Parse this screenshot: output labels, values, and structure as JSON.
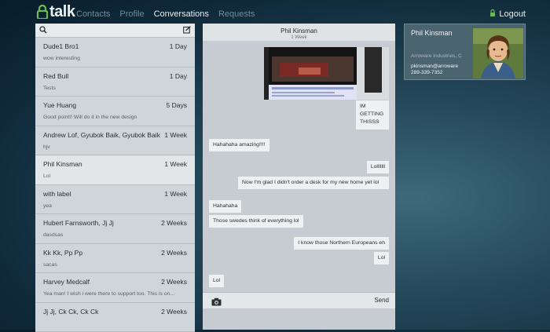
{
  "app": {
    "brand": "talk"
  },
  "nav": {
    "items": [
      "Contacts",
      "Profile",
      "Conversations",
      "Requests"
    ],
    "active": "Conversations"
  },
  "logout_label": "Logout",
  "conversations": [
    {
      "name": "Dude1 Bro1",
      "time": "1 Day",
      "preview": "wow interesting"
    },
    {
      "name": "Red Bull",
      "time": "1 Day",
      "preview": "Tests"
    },
    {
      "name": "Yue Huang",
      "time": "5 Days",
      "preview": "Good point!! Will do it in the new design"
    },
    {
      "name": "Andrew Lof, Gyubok Baik, Gyubok Baik",
      "time": "1 Week",
      "preview": "hjv"
    },
    {
      "name": "Phil Kinsman",
      "time": "1 Week",
      "preview": "Lol"
    },
    {
      "name": "with label",
      "time": "1 Week",
      "preview": "yea"
    },
    {
      "name": "Hubert Farnsworth, Jj Jj",
      "time": "2 Weeks",
      "preview": "dasdsas"
    },
    {
      "name": "Kk Kk, Pp Pp",
      "time": "2 Weeks",
      "preview": "sacas"
    },
    {
      "name": "Harvey Medcalf",
      "time": "2 Weeks",
      "preview": "Yea man! I wish i were there to support too. This is on..."
    },
    {
      "name": "Jj Jj, Ck Ck, Ck Ck",
      "time": "2 Weeks",
      "preview": ""
    }
  ],
  "chat": {
    "contact": "Phil Kinsman",
    "subtitle": "1 Week",
    "messages": [
      {
        "text": "IM GETTING THISSS",
        "side": "right"
      },
      {
        "text": "Hahahaha amazing!!!!",
        "side": "left"
      },
      {
        "text": "Lolllllll",
        "side": "right"
      },
      {
        "text": "Now I'm glad I didn't order a desk for my new home yet lol",
        "side": "right"
      },
      {
        "text": "Hahahaha",
        "side": "left"
      },
      {
        "text": "Those swedes think of everything lol",
        "side": "left"
      },
      {
        "text": "I know those Northern Europeans eh",
        "side": "right"
      },
      {
        "text": "Lol",
        "side": "right"
      },
      {
        "text": "Lol",
        "side": "left"
      }
    ],
    "send_label": "Send"
  },
  "profile": {
    "name": "Phil Kinsman",
    "company": "Arroware Industries, C",
    "email": "pkinsman@arroware",
    "phone": "289-339-7352"
  },
  "colors": {
    "accent_green": "#6abb57",
    "active_row": "#e2e6e9"
  }
}
